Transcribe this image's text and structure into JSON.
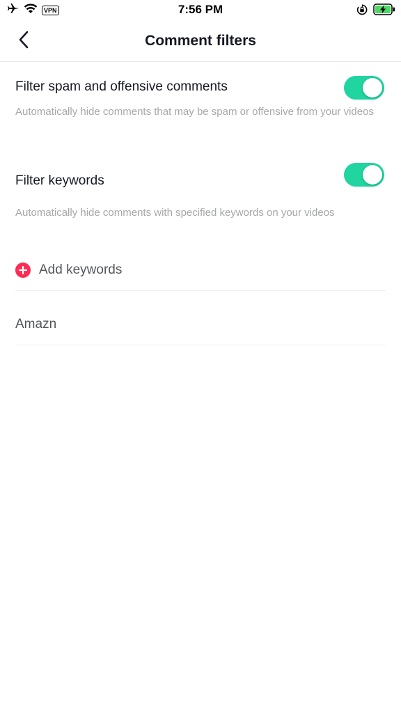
{
  "status_bar": {
    "time": "7:56 PM",
    "vpn": "VPN",
    "icons": [
      "airplane-icon",
      "wifi-icon",
      "orientation-lock-icon",
      "battery-charging-icon"
    ]
  },
  "nav": {
    "title": "Comment filters",
    "back_icon": "chevron-left-icon"
  },
  "settings": [
    {
      "title": "Filter spam and offensive comments",
      "description": "Automatically hide comments that may be spam or offensive from your videos",
      "enabled": true
    },
    {
      "title": "Filter keywords",
      "description": "Automatically hide comments with specified keywords on your videos",
      "enabled": true
    }
  ],
  "keywords": {
    "add_label": "Add keywords",
    "add_icon": "plus-circle-icon",
    "items": [
      "Amazn"
    ]
  },
  "colors": {
    "toggle_on": "#20d5a0",
    "accent": "#fe2c55",
    "secondary_text": "#a6a7ab"
  }
}
